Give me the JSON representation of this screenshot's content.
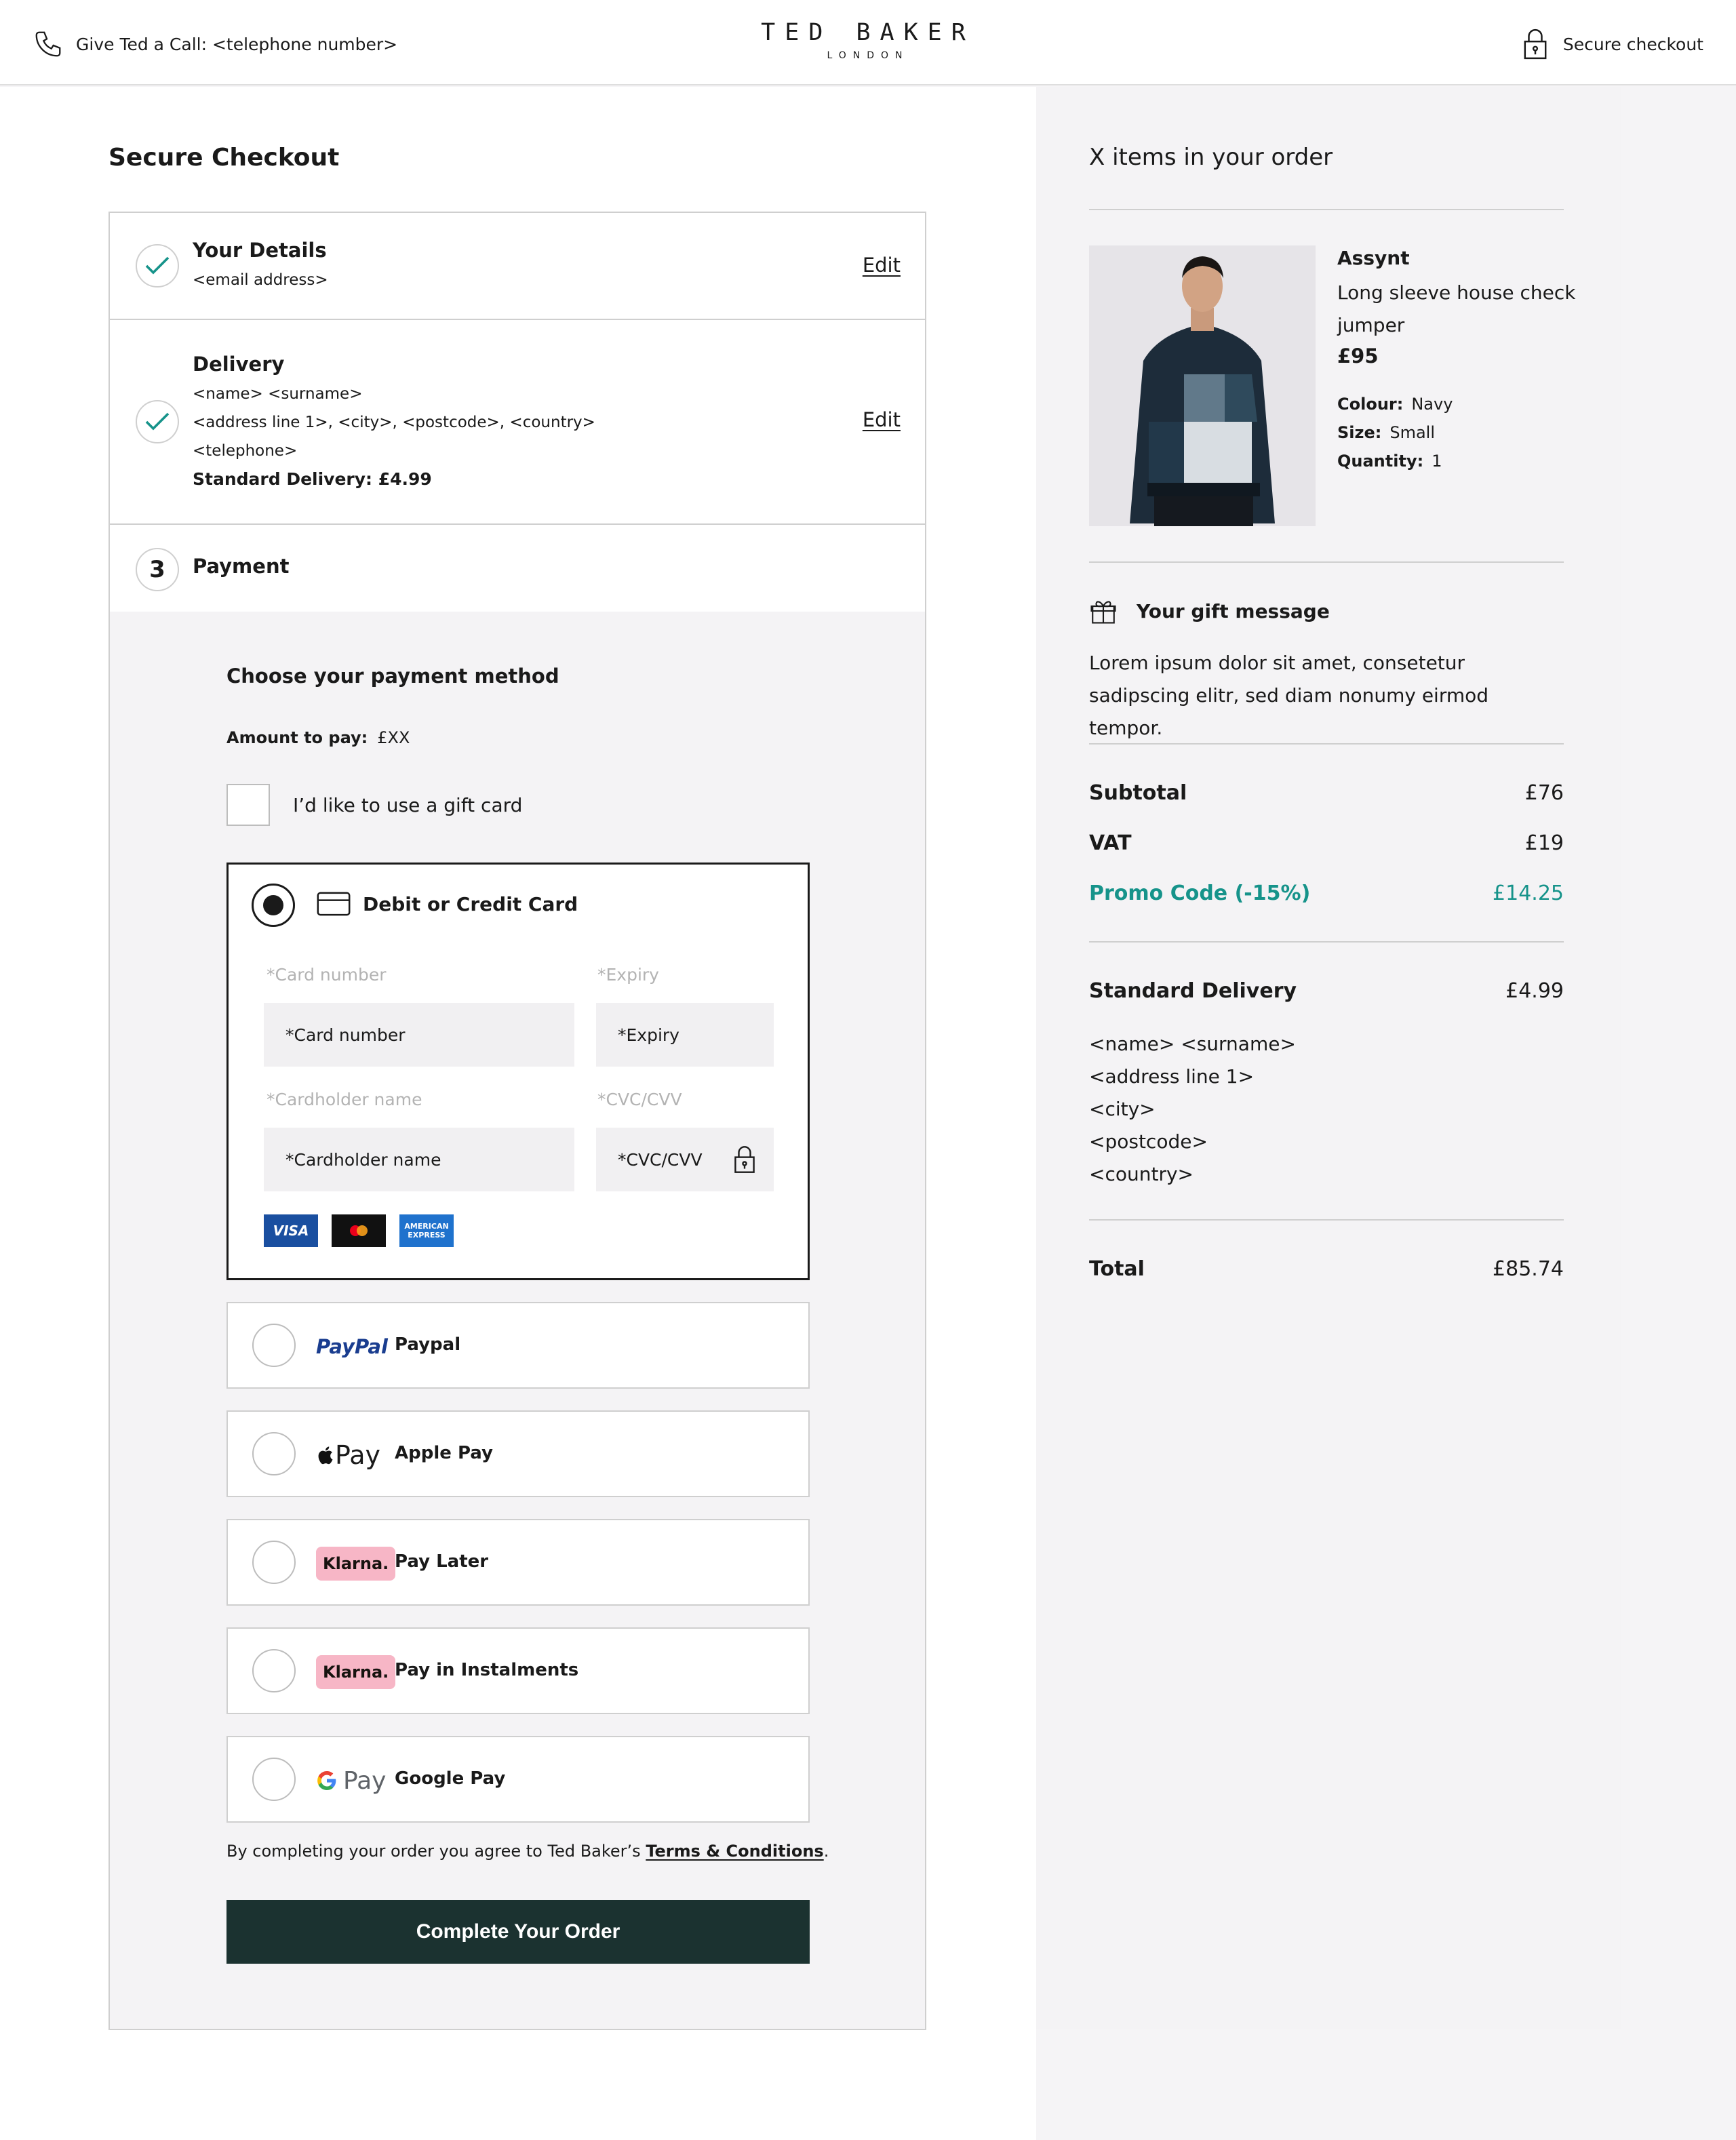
{
  "header": {
    "call_text": "Give Ted a Call: <telephone number>",
    "logo_main": "TED BAKER",
    "logo_sub": "LONDON",
    "secure_text": "Secure checkout"
  },
  "checkout": {
    "title": "Secure Checkout",
    "details": {
      "title": "Your Details",
      "email": "<email address>",
      "edit": "Edit"
    },
    "delivery": {
      "title": "Delivery",
      "name": "<name> <surname>",
      "address": "<address line 1>, <city>, <postcode>, <country>",
      "telephone": "<telephone>",
      "method": "Standard Delivery: £4.99",
      "edit": "Edit"
    },
    "payment": {
      "number": "3",
      "title": "Payment"
    }
  },
  "payment": {
    "heading": "Choose your payment method",
    "amount_label": "Amount to pay:",
    "amount_value": "£XX",
    "gift_card_label": "I’d like to use a gift card",
    "card": {
      "title": "Debit or Credit Card",
      "card_number_label": "*Card number",
      "card_number_placeholder": "*Card number",
      "expiry_label": "*Expiry",
      "expiry_placeholder": "*Expiry",
      "cardholder_label": "*Cardholder name",
      "cardholder_placeholder": "*Cardholder name",
      "cvc_label": "*CVC/CVV",
      "cvc_placeholder": "*CVC/CVV",
      "visa": "VISA",
      "amex_line1": "AMERICAN",
      "amex_line2": "EXPRESS"
    },
    "methods": [
      {
        "logo": "PayPal",
        "label": "Paypal"
      },
      {
        "logo": "Pay",
        "label": "Apple Pay"
      },
      {
        "logo": "Klarna.",
        "label": "Pay Later"
      },
      {
        "logo": "Klarna.",
        "label": "Pay in Instalments"
      },
      {
        "logo": "Pay",
        "label": "Google Pay"
      }
    ],
    "terms_prefix": "By completing your order you agree to Ted Baker’s ",
    "terms_link": "Terms & Conditions",
    "terms_suffix": ".",
    "complete_button": "Complete Your Order"
  },
  "summary": {
    "title": "X items in your order",
    "product": {
      "name": "Assynt",
      "description": "Long sleeve house check jumper",
      "price": "£95",
      "colour_label": "Colour:",
      "colour": "Navy",
      "size_label": "Size:",
      "size": "Small",
      "quantity_label": "Quantity:",
      "quantity": "1"
    },
    "gift_title": "Your gift message",
    "gift_message": "Lorem ipsum dolor sit amet, consetetur sadipscing elitr, sed diam nonumy eirmod tempor.",
    "subtotal_label": "Subtotal",
    "subtotal": "£76",
    "vat_label": "VAT",
    "vat": "£19",
    "promo_label": "Promo Code (-15%)",
    "promo": "£14.25",
    "delivery_label": "Standard Delivery",
    "delivery": "£4.99",
    "address": {
      "name": "<name> <surname>",
      "line1": "<address line 1>",
      "city": "<city>",
      "postcode": "<postcode>",
      "country": "<country>"
    },
    "total_label": "Total",
    "total": "£85.74"
  },
  "colors": {
    "accent": "#16938a",
    "button": "#1b3230",
    "klarna": "#f7b6c6",
    "visa": "#1a4fa0",
    "amex": "#1f72cd"
  }
}
